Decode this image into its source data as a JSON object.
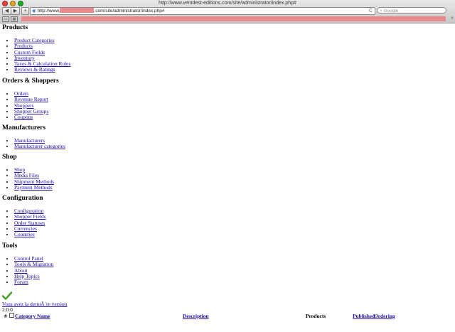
{
  "browser": {
    "title": "http://www.ventdest-editions.com/site/administrator/index.php#",
    "url_prefix": "http://www.",
    "url_suffix": ".com/site/administrator/index.php#",
    "search_placeholder": "Google",
    "back_label": "◀",
    "forward_label": "▶",
    "add_label": "+",
    "reload_label": "C",
    "more_label": "»",
    "colors": {
      "close": "#e0443e",
      "minimize": "#dea123",
      "zoom": "#1aab29",
      "redaction": "#e98a8a"
    }
  },
  "sections": [
    {
      "heading": "Products",
      "items": [
        "Product Categories",
        "Products",
        "Custom Fields",
        "Inventory",
        "Taxes & Calculation Rules",
        "Reviews & Ratings"
      ]
    },
    {
      "heading": "Orders & Shoppers",
      "items": [
        "Orders",
        "Revenue Report",
        "Shoppers",
        "Shopper Groups",
        "Coupons"
      ]
    },
    {
      "heading": "Manufacturers",
      "items": [
        "Manufacturers",
        "Manufacturer categories"
      ]
    },
    {
      "heading": "Shop",
      "items": [
        "Shop",
        "Media Files",
        "Shipment Methods",
        "Payment Methods"
      ]
    },
    {
      "heading": "Configuration",
      "items": [
        "Configuration",
        "Shopper Fields",
        "Order Statuses",
        "Currencies",
        "Countries"
      ]
    },
    {
      "heading": "Tools",
      "items": [
        "Control Panel",
        "Tools & Migration",
        "About",
        "Help Topics",
        "Forum"
      ]
    }
  ],
  "version": {
    "link": "Vous avez la derniÃ¨re version",
    "number": "2.0.0"
  },
  "table": {
    "hash": "#",
    "category_name": "Category Name",
    "description": "Description",
    "products": "Products",
    "published": "Published",
    "ordering": "Ordering"
  }
}
